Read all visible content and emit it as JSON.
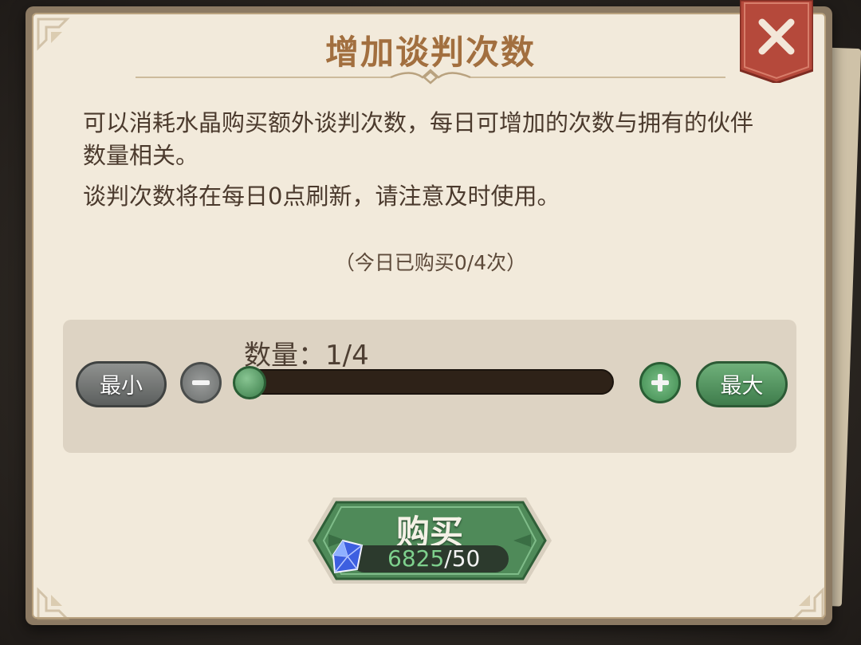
{
  "dialog": {
    "title": "增加谈判次数",
    "description_1": "可以消耗水晶购买额外谈判次数，每日可增加的次数与拥有的伙伴数量相关。",
    "description_2": "谈判次数将在每日0点刷新，请注意及时使用。",
    "purchased_today": "（今日已购买0/4次）",
    "close_icon": "close-icon"
  },
  "quantity": {
    "label": "数量：1/4",
    "min_label": "最小",
    "max_label": "最大",
    "current": 1,
    "max": 4,
    "minus_icon": "minus-icon",
    "plus_icon": "plus-icon"
  },
  "purchase": {
    "button_label": "购买",
    "crystals_owned": "6825",
    "separator": "/",
    "cost": "50",
    "currency_icon": "crystal-icon"
  },
  "colors": {
    "accent_green": "#3f7d4c",
    "title_brown": "#a26f3f",
    "close_red": "#b5493b",
    "owned_green": "#7ed08d"
  }
}
